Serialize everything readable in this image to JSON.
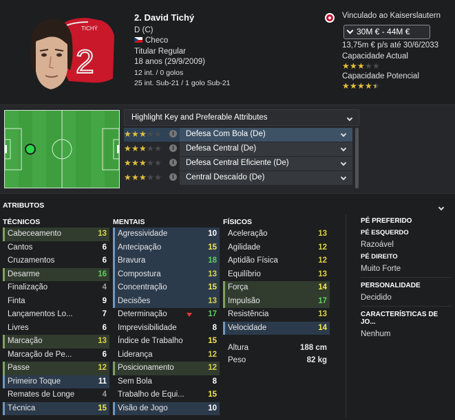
{
  "player": {
    "name": "2. David Tichý",
    "position": "D (C)",
    "nationality": "Checo",
    "status": "Titular Regular",
    "age": "18 anos (29/9/2009)",
    "caps": "12 int. / 0 golos",
    "u21": "25 int. Sub-21 / 1 golo Sub-21",
    "shirt_name": "TICHÝ",
    "shirt_number": "2"
  },
  "club": {
    "link": "Vinculado ao Kaiserslautern",
    "value": "30M € - 44M €",
    "contract": "13,75m € p/s até 30/6/2033",
    "current_ability_label": "Capacidade Actual",
    "current_ability_stars": 3,
    "potential_ability_label": "Capacidade Potencial",
    "potential_ability_stars": 4.5
  },
  "highlight": {
    "label": "Highlight Key and Preferable Attributes",
    "roles": [
      {
        "name": "Defesa Com Bola (De)",
        "stars": 3
      },
      {
        "name": "Defesa Central (De)",
        "stars": 3
      },
      {
        "name": "Defesa Central Eficiente (De)",
        "stars": 3
      },
      {
        "name": "Central Descaído (De)",
        "stars": 3
      }
    ]
  },
  "attributes": {
    "header": "ATRIBUTOS",
    "tecnicos": {
      "title": "TÉCNICOS",
      "rows": [
        {
          "n": "Cabeceamento",
          "v": "13"
        },
        {
          "n": "Cantos",
          "v": "6"
        },
        {
          "n": "Cruzamentos",
          "v": "6"
        },
        {
          "n": "Desarme",
          "v": "16"
        },
        {
          "n": "Finalização",
          "v": "4"
        },
        {
          "n": "Finta",
          "v": "9"
        },
        {
          "n": "Lançamentos Lo...",
          "v": "7"
        },
        {
          "n": "Livres",
          "v": "6"
        },
        {
          "n": "Marcação",
          "v": "13"
        },
        {
          "n": "Marcação de Pe...",
          "v": "6"
        },
        {
          "n": "Passe",
          "v": "12"
        },
        {
          "n": "Primeiro Toque",
          "v": "11"
        },
        {
          "n": "Remates de Longe",
          "v": "4"
        },
        {
          "n": "Técnica",
          "v": "15"
        }
      ]
    },
    "mentais": {
      "title": "MENTAIS",
      "rows": [
        {
          "n": "Agressividade",
          "v": "10"
        },
        {
          "n": "Antecipação",
          "v": "15"
        },
        {
          "n": "Bravura",
          "v": "18"
        },
        {
          "n": "Compostura",
          "v": "13"
        },
        {
          "n": "Concentração",
          "v": "15"
        },
        {
          "n": "Decisões",
          "v": "13"
        },
        {
          "n": "Determinação",
          "v": "17"
        },
        {
          "n": "Imprevisibilidade",
          "v": "8"
        },
        {
          "n": "Índice de Trabalho",
          "v": "15"
        },
        {
          "n": "Liderança",
          "v": "12"
        },
        {
          "n": "Posicionamento",
          "v": "12"
        },
        {
          "n": "Sem Bola",
          "v": "8"
        },
        {
          "n": "Trabalho de Equi...",
          "v": "15"
        },
        {
          "n": "Visão de Jogo",
          "v": "10"
        }
      ]
    },
    "fisicos": {
      "title": "FÍSICOS",
      "rows": [
        {
          "n": "Aceleração",
          "v": "13"
        },
        {
          "n": "Agilidade",
          "v": "12"
        },
        {
          "n": "Aptidão Física",
          "v": "12"
        },
        {
          "n": "Equilíbrio",
          "v": "13"
        },
        {
          "n": "Força",
          "v": "14"
        },
        {
          "n": "Impulsão",
          "v": "17"
        },
        {
          "n": "Resistência",
          "v": "13"
        },
        {
          "n": "Velocidade",
          "v": "14"
        }
      ],
      "height_label": "Altura",
      "height": "188 cm",
      "weight_label": "Peso",
      "weight": "82 kg"
    }
  },
  "side": {
    "foot_title": "PÉ PREFERIDO",
    "left_title": "PÉ ESQUERDO",
    "left_value": "Razoável",
    "right_title": "PÉ DIREITO",
    "right_value": "Muito Forte",
    "pers_title": "PERSONALIDADE",
    "pers_value": "Decidido",
    "traits_title": "CARACTERÍSTICAS DE JO...",
    "traits_value": "Nenhum"
  }
}
